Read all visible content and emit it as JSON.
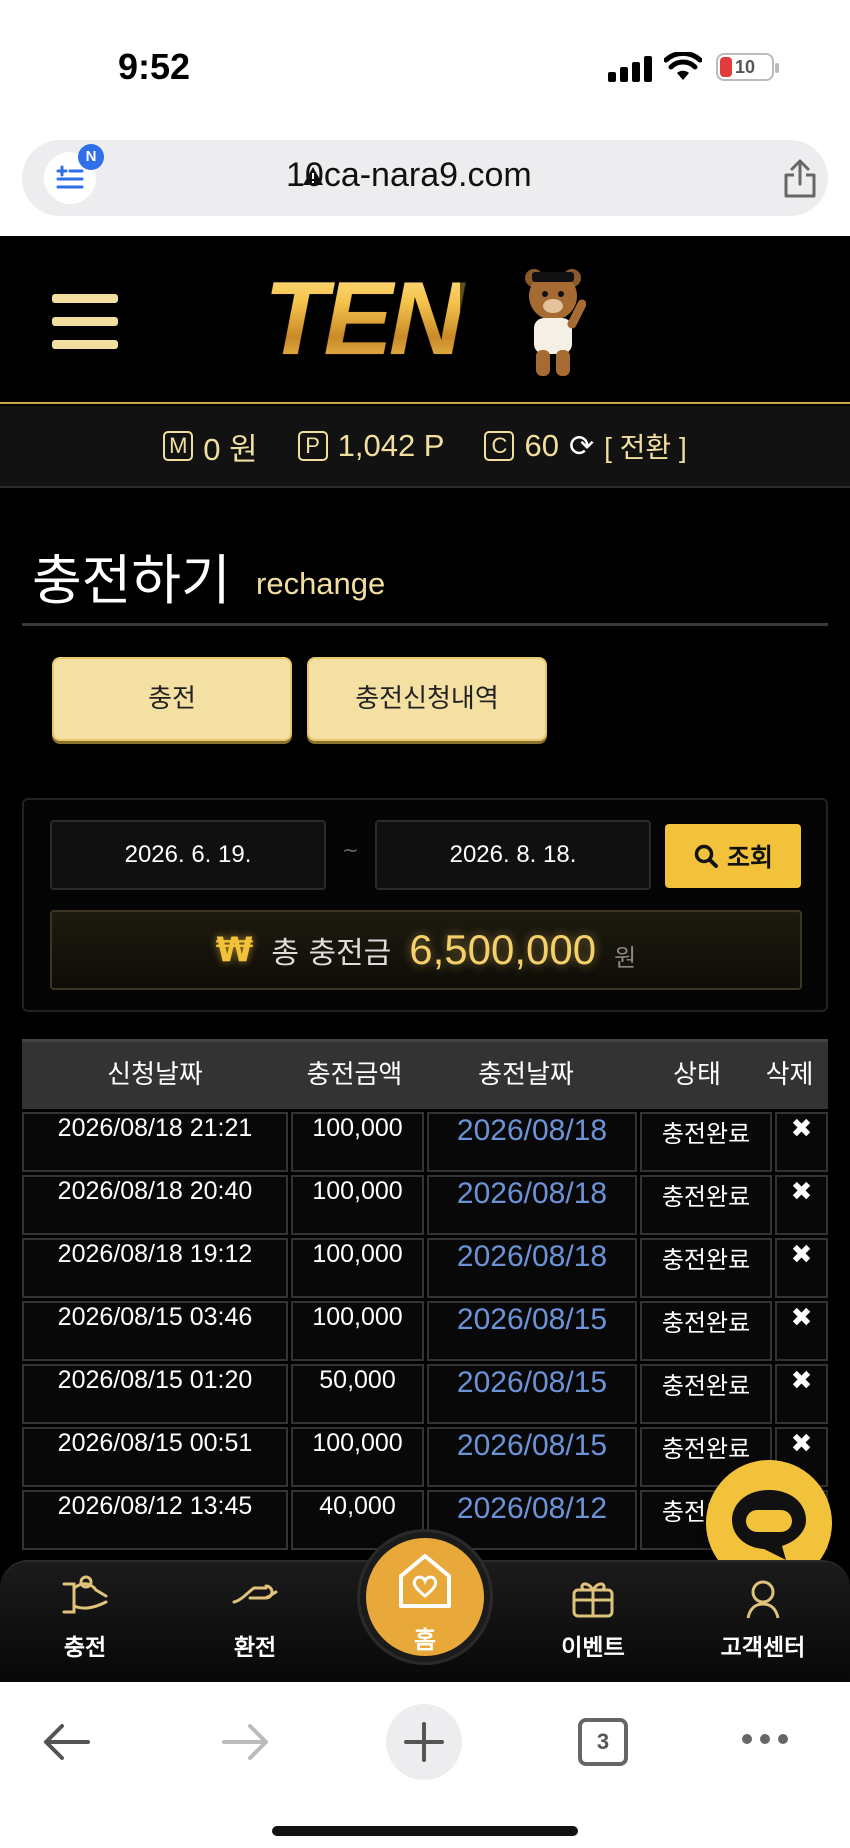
{
  "status_bar": {
    "time": "9:52",
    "battery": "10"
  },
  "browser": {
    "url": "10ca-nara9.com",
    "reader_badge": "N",
    "tabs_count": "3"
  },
  "site": {
    "logo": "TEN"
  },
  "balance": {
    "money_icon": "M",
    "money": "0 원",
    "point_icon": "P",
    "points": "1,042 P",
    "coin_icon": "C",
    "coins": "60",
    "switch_label": "[ 전환 ]"
  },
  "page": {
    "title": "충전하기",
    "subtitle": "rechange",
    "tab_charge": "충전",
    "tab_history": "충전신청내역"
  },
  "filter": {
    "date_from": "2026. 6. 19.",
    "separator": "~",
    "date_to": "2026. 8. 18.",
    "search_label": "조회",
    "total_symbol": "₩",
    "total_label": "총 충전금",
    "total_amount": "6,500,000",
    "total_unit": "원"
  },
  "table": {
    "headers": [
      "신청날짜",
      "충전금액",
      "충전날짜",
      "상태",
      "삭제"
    ],
    "rows": [
      [
        "2026/08/18 21:21",
        "100,000",
        "2026/08/18",
        "충전완료",
        "✖"
      ],
      [
        "2026/08/18 20:40",
        "100,000",
        "2026/08/18",
        "충전완료",
        "✖"
      ],
      [
        "2026/08/18 19:12",
        "100,000",
        "2026/08/18",
        "충전완료",
        "✖"
      ],
      [
        "2026/08/15 03:46",
        "100,000",
        "2026/08/15",
        "충전완료",
        "✖"
      ],
      [
        "2026/08/15 01:20",
        "50,000",
        "2026/08/15",
        "충전완료",
        "✖"
      ],
      [
        "2026/08/15 00:51",
        "100,000",
        "2026/08/15",
        "충전완료",
        "✖"
      ],
      [
        "2026/08/12 13:45",
        "40,000",
        "2026/08/12",
        "충전완료",
        "✖"
      ]
    ]
  },
  "bottom_nav": {
    "charge": "충전",
    "exchange": "환전",
    "home": "홈",
    "event": "이벤트",
    "support": "고객센터"
  },
  "colors": {
    "accent_gold": "#f2c23a",
    "pale_gold": "#f3e0a2",
    "link_blue": "#6b93d8"
  }
}
